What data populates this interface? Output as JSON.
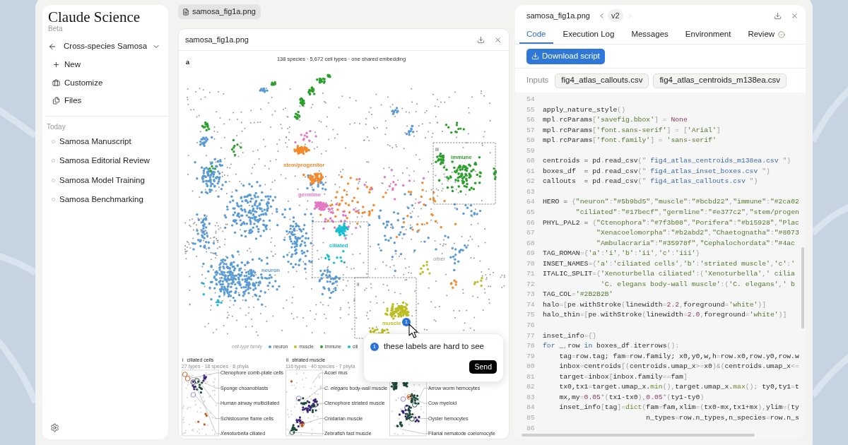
{
  "sidebar": {
    "brand": "Claude Science",
    "badge": "Beta",
    "project": "Cross-species Samosa",
    "actions": [
      {
        "label": "New"
      },
      {
        "label": "Customize"
      },
      {
        "label": "Files"
      }
    ],
    "section": "Today",
    "sessions": [
      {
        "label": "Samosa Manuscript",
        "selected": false
      },
      {
        "label": "Samosa Editorial Review",
        "selected": false
      },
      {
        "label": "Samosa Model Training",
        "selected": false
      },
      {
        "label": "Samosa Benchmarking",
        "selected": false
      }
    ]
  },
  "file_tabs": [
    {
      "label": "samosa_fig1a.png",
      "selected": true
    }
  ],
  "preview": {
    "title": "samosa_fig1a.png",
    "figure": {
      "panel_letter": "a",
      "title": "138 species · 5,672 cell types · one shared embedding",
      "clusters": [
        {
          "label": "neuron",
          "color": "#5b9bd5"
        },
        {
          "label": "stem/progenitor",
          "color": "#f28a2e"
        },
        {
          "label": "germline",
          "color": "#e377c2"
        },
        {
          "label": "ciliated",
          "color": "#17becf"
        },
        {
          "label": "immune",
          "color": "#2ca02c"
        },
        {
          "label": "muscle",
          "color": "#bcbd22"
        },
        {
          "label": "other",
          "color": "#999999"
        }
      ],
      "region_tags": [
        "iii",
        "ii"
      ],
      "legend": {
        "title": "cell-type family",
        "items": [
          {
            "label": "neuron",
            "color": "#5b9bd5"
          },
          {
            "label": "muscle",
            "color": "#bcbd22"
          },
          {
            "label": "immune",
            "color": "#2ca02c"
          },
          {
            "label": "cili",
            "color": "#17becf"
          }
        ]
      },
      "insets": [
        {
          "tag": "i",
          "title": "ciliated cells",
          "subtitle": "27 types · 18 species · 8 phyla",
          "labels": [
            "Ctenophore comb-plate cells",
            "Sponge choanoblasts",
            "Human airway multiciliated",
            "Schistosome flame cells",
            "*Xenoturbella* ciliated"
          ]
        },
        {
          "tag": "ii",
          "title": "striated muscle",
          "subtitle": "116 types · 40 species · 7 phyla",
          "labels": [
            "Acoel mus",
            "*C. elegans* body-wall muscle",
            "Ctenophore striated muscle",
            "Cnidarian muscle",
            "Zebrafish fast muscle"
          ]
        },
        {
          "labels": [
            "Arrow worm hemocytes",
            "Cow myeloid",
            "Oyster hemocytes",
            "Filarial nematode coelomocyte"
          ]
        }
      ]
    },
    "comment": {
      "marker": "1",
      "badge": "1",
      "text": "these labels are hard to see",
      "send": "Send"
    }
  },
  "code_panel": {
    "title": "samosa_fig1a.png",
    "version": {
      "label": "v2",
      "previous_disabled": false,
      "next_disabled": true
    },
    "tabs": [
      {
        "label": "Code",
        "selected": true,
        "verified": false
      },
      {
        "label": "Execution Log",
        "selected": false,
        "verified": false
      },
      {
        "label": "Messages",
        "selected": false,
        "verified": false
      },
      {
        "label": "Environment",
        "selected": false,
        "verified": false
      },
      {
        "label": "Review",
        "selected": false,
        "verified": true
      }
    ],
    "download_button": "Download script",
    "inputs": {
      "label": "Inputs",
      "files": [
        "fig4_atlas_callouts.csv",
        "fig4_atlas_centroids_m138ea.csv"
      ]
    },
    "lines": [
      {
        "number": "54"
      },
      {
        "number": "55",
        "tokens": [
          {
            "kind": "plain",
            "text": "apply_nature_style"
          },
          {
            "kind": "punct",
            "text": "()"
          }
        ]
      },
      {
        "number": "56",
        "tokens": [
          {
            "kind": "plain",
            "text": "mpl"
          },
          {
            "kind": "punct",
            "text": "."
          },
          {
            "kind": "plain",
            "text": "rcParams"
          },
          {
            "kind": "punct",
            "text": "["
          },
          {
            "kind": "string",
            "text": "'savefig.bbox'"
          },
          {
            "kind": "punct",
            "text": "] = "
          },
          {
            "kind": "number",
            "text": "None"
          }
        ]
      },
      {
        "number": "57",
        "tokens": [
          {
            "kind": "plain",
            "text": "mpl"
          },
          {
            "kind": "punct",
            "text": "."
          },
          {
            "kind": "plain",
            "text": "rcParams"
          },
          {
            "kind": "punct",
            "text": "["
          },
          {
            "kind": "string",
            "text": "'font.sans-serif'"
          },
          {
            "kind": "punct",
            "text": "] = ["
          },
          {
            "kind": "string",
            "text": "'Arial'"
          },
          {
            "kind": "punct",
            "text": "]"
          }
        ]
      },
      {
        "number": "58",
        "tokens": [
          {
            "kind": "plain",
            "text": "mpl"
          },
          {
            "kind": "punct",
            "text": "."
          },
          {
            "kind": "plain",
            "text": "rcParams"
          },
          {
            "kind": "punct",
            "text": "["
          },
          {
            "kind": "string",
            "text": "'font.family'"
          },
          {
            "kind": "punct",
            "text": "] = "
          },
          {
            "kind": "string",
            "text": "'sans-serif'"
          }
        ]
      },
      {
        "number": "59"
      },
      {
        "number": "60",
        "tokens": [
          {
            "kind": "plain",
            "text": "centroids = pd"
          },
          {
            "kind": "punct",
            "text": "."
          },
          {
            "kind": "plain",
            "text": "read_csv"
          },
          {
            "kind": "punct",
            "text": "(\" "
          },
          {
            "kind": "file",
            "text": "fig4_atlas_centroids_m138ea.csv"
          },
          {
            "kind": "punct",
            "text": " \")"
          }
        ]
      },
      {
        "number": "61",
        "tokens": [
          {
            "kind": "plain",
            "text": "boxes_df  = pd"
          },
          {
            "kind": "punct",
            "text": "."
          },
          {
            "kind": "plain",
            "text": "read_csv"
          },
          {
            "kind": "punct",
            "text": "(\" "
          },
          {
            "kind": "file",
            "text": "fig4_atlas_inset_boxes.csv"
          },
          {
            "kind": "punct",
            "text": " \")"
          }
        ]
      },
      {
        "number": "62",
        "tokens": [
          {
            "kind": "plain",
            "text": "callouts  = pd"
          },
          {
            "kind": "punct",
            "text": "."
          },
          {
            "kind": "plain",
            "text": "read_csv"
          },
          {
            "kind": "punct",
            "text": "(\" "
          },
          {
            "kind": "file",
            "text": "fig4_atlas_callouts.csv"
          },
          {
            "kind": "punct",
            "text": " \")"
          }
        ]
      },
      {
        "number": "63"
      },
      {
        "number": "64",
        "tokens": [
          {
            "kind": "plain",
            "text": "HERO = "
          },
          {
            "kind": "punct",
            "text": "{"
          },
          {
            "kind": "string",
            "text": "\"neuron\""
          },
          {
            "kind": "punct",
            "text": ":"
          },
          {
            "kind": "string",
            "text": "\"#5b9bd5\""
          },
          {
            "kind": "punct",
            "text": ","
          },
          {
            "kind": "string",
            "text": "\"muscle\""
          },
          {
            "kind": "punct",
            "text": ":"
          },
          {
            "kind": "string",
            "text": "\"#bcbd22\""
          },
          {
            "kind": "punct",
            "text": ","
          },
          {
            "kind": "string",
            "text": "\"immune\""
          },
          {
            "kind": "punct",
            "text": ":"
          },
          {
            "kind": "string",
            "text": "\"#2ca02"
          }
        ]
      },
      {
        "number": "65",
        "tokens": [
          {
            "kind": "string",
            "text": "        \"ciliated\""
          },
          {
            "kind": "punct",
            "text": ":"
          },
          {
            "kind": "string",
            "text": "\"#17becf\""
          },
          {
            "kind": "punct",
            "text": ","
          },
          {
            "kind": "string",
            "text": "\"germline\""
          },
          {
            "kind": "punct",
            "text": ":"
          },
          {
            "kind": "string",
            "text": "\"#e377c2\""
          },
          {
            "kind": "punct",
            "text": ","
          },
          {
            "kind": "string",
            "text": "\"stem/progen"
          }
        ]
      },
      {
        "number": "66",
        "tokens": [
          {
            "kind": "plain",
            "text": "PHYL_PAL2 = "
          },
          {
            "kind": "punct",
            "text": "{"
          },
          {
            "kind": "string",
            "text": "\"Ctenophora\""
          },
          {
            "kind": "punct",
            "text": ":"
          },
          {
            "kind": "string",
            "text": "\"#7f3b08\""
          },
          {
            "kind": "punct",
            "text": ","
          },
          {
            "kind": "string",
            "text": "\"Porifera\""
          },
          {
            "kind": "punct",
            "text": ":"
          },
          {
            "kind": "string",
            "text": "\"#b15928\""
          },
          {
            "kind": "punct",
            "text": ","
          },
          {
            "kind": "string",
            "text": "\"Plac"
          }
        ]
      },
      {
        "number": "67",
        "tokens": [
          {
            "kind": "string",
            "text": "             \"Xenacoelomorpha\""
          },
          {
            "kind": "punct",
            "text": ":"
          },
          {
            "kind": "string",
            "text": "\"#b2abd2\""
          },
          {
            "kind": "punct",
            "text": ","
          },
          {
            "kind": "string",
            "text": "\"Chaetognatha\""
          },
          {
            "kind": "punct",
            "text": ":"
          },
          {
            "kind": "string",
            "text": "\"#8073"
          }
        ]
      },
      {
        "number": "68",
        "tokens": [
          {
            "kind": "string",
            "text": "             \"Ambulacraria\""
          },
          {
            "kind": "punct",
            "text": ":"
          },
          {
            "kind": "string",
            "text": "\"#35978f\""
          },
          {
            "kind": "punct",
            "text": ","
          },
          {
            "kind": "string",
            "text": "\"Cephalochordata\""
          },
          {
            "kind": "punct",
            "text": ":"
          },
          {
            "kind": "string",
            "text": "\"#4ac"
          }
        ]
      },
      {
        "number": "69",
        "tokens": [
          {
            "kind": "plain",
            "text": "TAG_ROMAN"
          },
          {
            "kind": "punct",
            "text": "={"
          },
          {
            "kind": "string",
            "text": "'a'"
          },
          {
            "kind": "punct",
            "text": ":"
          },
          {
            "kind": "string",
            "text": "'i'"
          },
          {
            "kind": "punct",
            "text": ","
          },
          {
            "kind": "string",
            "text": "'b'"
          },
          {
            "kind": "punct",
            "text": ":"
          },
          {
            "kind": "string",
            "text": "'ii'"
          },
          {
            "kind": "punct",
            "text": ","
          },
          {
            "kind": "string",
            "text": "'c'"
          },
          {
            "kind": "punct",
            "text": ":"
          },
          {
            "kind": "string",
            "text": "'iii'"
          },
          {
            "kind": "punct",
            "text": "}"
          }
        ]
      },
      {
        "number": "70",
        "tokens": [
          {
            "kind": "plain",
            "text": "INSET_NAMES"
          },
          {
            "kind": "punct",
            "text": "={"
          },
          {
            "kind": "string",
            "text": "'a'"
          },
          {
            "kind": "punct",
            "text": ":"
          },
          {
            "kind": "string",
            "text": "'ciliated cells'"
          },
          {
            "kind": "punct",
            "text": ","
          },
          {
            "kind": "string",
            "text": "'b'"
          },
          {
            "kind": "punct",
            "text": ":"
          },
          {
            "kind": "string",
            "text": "'striated muscle'"
          },
          {
            "kind": "punct",
            "text": ","
          },
          {
            "kind": "string",
            "text": "'c'"
          },
          {
            "kind": "punct",
            "text": ":"
          },
          {
            "kind": "string",
            "text": "'"
          }
        ]
      },
      {
        "number": "71",
        "tokens": [
          {
            "kind": "plain",
            "text": "ITALIC_SPLIT"
          },
          {
            "kind": "punct",
            "text": "={"
          },
          {
            "kind": "string",
            "text": "'Xenoturbella ciliated'"
          },
          {
            "kind": "punct",
            "text": ":("
          },
          {
            "kind": "string",
            "text": "'Xenoturbella'"
          },
          {
            "kind": "punct",
            "text": ","
          },
          {
            "kind": "string",
            "text": "' cilia"
          }
        ]
      },
      {
        "number": "72",
        "tokens": [
          {
            "kind": "string",
            "text": "              'C. elegans body-wall muscle'"
          },
          {
            "kind": "punct",
            "text": ":("
          },
          {
            "kind": "string",
            "text": "'C. elegans'"
          },
          {
            "kind": "punct",
            "text": ","
          },
          {
            "kind": "string",
            "text": "' b"
          }
        ]
      },
      {
        "number": "73",
        "tokens": [
          {
            "kind": "plain",
            "text": "TAG_COL"
          },
          {
            "kind": "punct",
            "text": "="
          },
          {
            "kind": "string",
            "text": "'#2B2B2B'"
          }
        ]
      },
      {
        "number": "74",
        "tokens": [
          {
            "kind": "plain",
            "text": "halo"
          },
          {
            "kind": "punct",
            "text": "=["
          },
          {
            "kind": "plain",
            "text": "pe"
          },
          {
            "kind": "punct",
            "text": "."
          },
          {
            "kind": "plain",
            "text": "withStroke"
          },
          {
            "kind": "punct",
            "text": "("
          },
          {
            "kind": "plain",
            "text": "linewidth"
          },
          {
            "kind": "punct",
            "text": "="
          },
          {
            "kind": "number",
            "text": "2.2"
          },
          {
            "kind": "punct",
            "text": ","
          },
          {
            "kind": "plain",
            "text": "foreground"
          },
          {
            "kind": "punct",
            "text": "="
          },
          {
            "kind": "string",
            "text": "'white'"
          },
          {
            "kind": "punct",
            "text": ")]"
          }
        ]
      },
      {
        "number": "75",
        "tokens": [
          {
            "kind": "plain",
            "text": "halo_thin"
          },
          {
            "kind": "punct",
            "text": "=["
          },
          {
            "kind": "plain",
            "text": "pe"
          },
          {
            "kind": "punct",
            "text": "."
          },
          {
            "kind": "plain",
            "text": "withStroke"
          },
          {
            "kind": "punct",
            "text": "("
          },
          {
            "kind": "plain",
            "text": "linewidth"
          },
          {
            "kind": "punct",
            "text": "="
          },
          {
            "kind": "number",
            "text": "2.0"
          },
          {
            "kind": "punct",
            "text": ","
          },
          {
            "kind": "plain",
            "text": "foreground"
          },
          {
            "kind": "punct",
            "text": "="
          },
          {
            "kind": "string",
            "text": "'white'"
          },
          {
            "kind": "punct",
            "text": ")]"
          }
        ]
      },
      {
        "number": "76"
      },
      {
        "number": "77",
        "tokens": [
          {
            "kind": "plain",
            "text": "inset_info"
          },
          {
            "kind": "punct",
            "text": "={}"
          }
        ]
      },
      {
        "number": "78",
        "tokens": [
          {
            "kind": "keyword",
            "text": "for"
          },
          {
            "kind": "plain",
            "text": " _"
          },
          {
            "kind": "punct",
            "text": ","
          },
          {
            "kind": "plain",
            "text": "row "
          },
          {
            "kind": "keyword",
            "text": "in"
          },
          {
            "kind": "plain",
            "text": " boxes_df"
          },
          {
            "kind": "punct",
            "text": "."
          },
          {
            "kind": "plain",
            "text": "iterrows"
          },
          {
            "kind": "punct",
            "text": "():"
          }
        ]
      },
      {
        "number": "79",
        "tokens": [
          {
            "kind": "plain",
            "text": "    tag"
          },
          {
            "kind": "punct",
            "text": "="
          },
          {
            "kind": "plain",
            "text": "row.tag; fam"
          },
          {
            "kind": "punct",
            "text": "="
          },
          {
            "kind": "plain",
            "text": "row.family; x0,y0,w,h"
          },
          {
            "kind": "punct",
            "text": "="
          },
          {
            "kind": "plain",
            "text": "row.x0,row.y0,row.w"
          }
        ]
      },
      {
        "number": "80",
        "tokens": [
          {
            "kind": "plain",
            "text": "    inbox"
          },
          {
            "kind": "punct",
            "text": "="
          },
          {
            "kind": "plain",
            "text": "centroids"
          },
          {
            "kind": "punct",
            "text": "[("
          },
          {
            "kind": "plain",
            "text": "centroids.umap_x"
          },
          {
            "kind": "punct",
            "text": ">="
          },
          {
            "kind": "plain",
            "text": "x0"
          },
          {
            "kind": "punct",
            "text": ")&("
          },
          {
            "kind": "plain",
            "text": "centroids.umap_x"
          },
          {
            "kind": "punct",
            "text": "<="
          }
        ]
      },
      {
        "number": "81",
        "tokens": [
          {
            "kind": "plain",
            "text": "    target"
          },
          {
            "kind": "punct",
            "text": "="
          },
          {
            "kind": "plain",
            "text": "inbox"
          },
          {
            "kind": "punct",
            "text": "["
          },
          {
            "kind": "plain",
            "text": "inbox.family"
          },
          {
            "kind": "punct",
            "text": "=="
          },
          {
            "kind": "plain",
            "text": "fam"
          },
          {
            "kind": "punct",
            "text": "]"
          }
        ]
      },
      {
        "number": "82",
        "tokens": [
          {
            "kind": "plain",
            "text": "    tx0,tx1"
          },
          {
            "kind": "punct",
            "text": "="
          },
          {
            "kind": "plain",
            "text": "target.umap_x."
          },
          {
            "kind": "builtin",
            "text": "min"
          },
          {
            "kind": "punct",
            "text": "(),"
          },
          {
            "kind": "plain",
            "text": "target.umap_x."
          },
          {
            "kind": "builtin",
            "text": "max"
          },
          {
            "kind": "punct",
            "text": "();"
          },
          {
            "kind": "plain",
            "text": " ty0,ty1"
          },
          {
            "kind": "punct",
            "text": "="
          },
          {
            "kind": "plain",
            "text": "t"
          }
        ]
      },
      {
        "number": "83",
        "tokens": [
          {
            "kind": "plain",
            "text": "    mx,my"
          },
          {
            "kind": "punct",
            "text": "="
          },
          {
            "kind": "number",
            "text": "0.05"
          },
          {
            "kind": "punct",
            "text": "*("
          },
          {
            "kind": "plain",
            "text": "tx1-tx0"
          },
          {
            "kind": "punct",
            "text": "),"
          },
          {
            "kind": "number",
            "text": "0.05"
          },
          {
            "kind": "punct",
            "text": "*("
          },
          {
            "kind": "plain",
            "text": "ty1-ty0"
          },
          {
            "kind": "punct",
            "text": ")"
          }
        ]
      },
      {
        "number": "84",
        "tokens": [
          {
            "kind": "plain",
            "text": "    inset_info"
          },
          {
            "kind": "punct",
            "text": "["
          },
          {
            "kind": "plain",
            "text": "tag"
          },
          {
            "kind": "punct",
            "text": "]="
          },
          {
            "kind": "builtin",
            "text": "dict"
          },
          {
            "kind": "punct",
            "text": "("
          },
          {
            "kind": "plain",
            "text": "fam"
          },
          {
            "kind": "punct",
            "text": "="
          },
          {
            "kind": "plain",
            "text": "fam,xlim"
          },
          {
            "kind": "punct",
            "text": "=("
          },
          {
            "kind": "plain",
            "text": "tx0-mx,tx1+mx"
          },
          {
            "kind": "punct",
            "text": "),"
          },
          {
            "kind": "plain",
            "text": "ylim"
          },
          {
            "kind": "punct",
            "text": "=("
          },
          {
            "kind": "plain",
            "text": "ty"
          }
        ]
      },
      {
        "number": "85",
        "tokens": [
          {
            "kind": "plain",
            "text": "                         n_types"
          },
          {
            "kind": "punct",
            "text": "="
          },
          {
            "kind": "plain",
            "text": "row.n_types,n_species"
          },
          {
            "kind": "punct",
            "text": "="
          },
          {
            "kind": "plain",
            "text": "row.n_s"
          }
        ]
      },
      {
        "number": "86"
      }
    ]
  }
}
